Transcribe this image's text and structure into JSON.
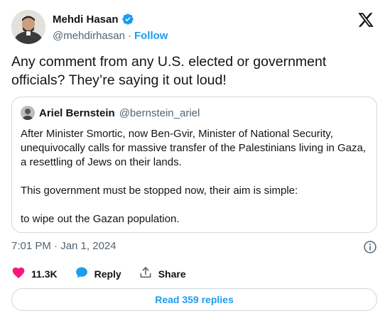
{
  "author": {
    "name": "Mehdi Hasan",
    "handle": "@mehdirhasan",
    "separator": "·",
    "follow_label": "Follow"
  },
  "tweet": {
    "text": "Any comment from any U.S. elected or government officials? They’re saying it out loud!"
  },
  "quote": {
    "name": "Ariel Bernstein",
    "handle": "@bernstein_ariel",
    "paragraphs": [
      "After Minister Smortic, now Ben-Gvir, Minister of National Security, unequivocally calls for massive transfer of the Palestinians living in Gaza, a resettling of Jews on their lands.",
      "This government must be stopped now, their aim is simple:",
      "to wipe out the Gazan population."
    ]
  },
  "meta": {
    "timestamp": "7:01 PM · Jan 1, 2024"
  },
  "actions": {
    "likes": "11.3K",
    "reply_label": "Reply",
    "share_label": "Share"
  },
  "read_replies_label": "Read 359 replies",
  "colors": {
    "accent": "#1d9bf0",
    "like": "#f91880",
    "muted": "#536471",
    "border": "#cfd9de"
  },
  "icons": [
    "verified-badge-icon",
    "x-logo-icon",
    "info-icon",
    "heart-icon",
    "reply-bubble-icon",
    "share-icon"
  ]
}
